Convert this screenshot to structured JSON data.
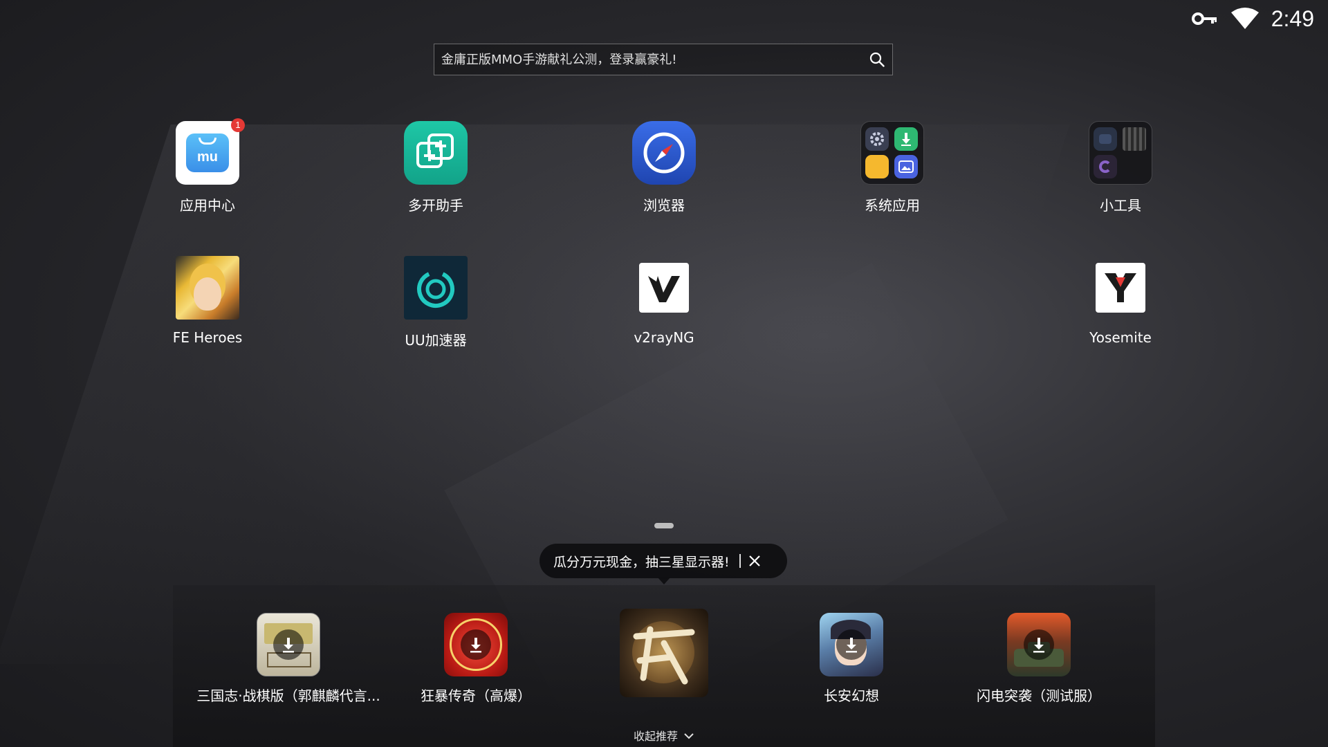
{
  "status_bar": {
    "time": "2:49",
    "icons": [
      "vpn-key-icon",
      "wifi-icon"
    ]
  },
  "search": {
    "placeholder": "金庸正版MMO手游献礼公测，登录赢豪礼!",
    "icon": "search-icon"
  },
  "apps": [
    {
      "label": "应用中心",
      "icon": "app-center-icon",
      "badge": "1"
    },
    {
      "label": "多开助手",
      "icon": "multi-open-icon"
    },
    {
      "label": "浏览器",
      "icon": "compass-browser-icon"
    },
    {
      "label": "系统应用",
      "icon": "system-apps-folder-icon"
    },
    {
      "label": "小工具",
      "icon": "tools-folder-icon"
    },
    {
      "label": "FE Heroes",
      "icon": "fe-heroes-icon"
    },
    {
      "label": "UU加速器",
      "icon": "uu-accelerator-icon"
    },
    {
      "label": "v2rayNG",
      "icon": "v2rayng-icon"
    },
    {
      "label": "Yosemite",
      "icon": "yosemite-icon"
    }
  ],
  "promo": {
    "text": "瓜分万元现金，抽三星显示器!",
    "close_icon": "close-icon"
  },
  "recommended": [
    {
      "label": "三国志·战棋版（郭麒麟代言...",
      "icon": "sanguozhi-game-icon",
      "download": true
    },
    {
      "label": "狂暴传奇（高爆）",
      "icon": "kuangbao-chuanqi-icon",
      "download": true
    },
    {
      "label": "",
      "icon": "tianlong-game-icon",
      "download": false
    },
    {
      "label": "长安幻想",
      "icon": "changan-huanxiang-icon",
      "download": true
    },
    {
      "label": "闪电突袭（测试服）",
      "icon": "shandian-tuxi-icon",
      "download": true
    }
  ],
  "collapse": {
    "label": "收起推荐",
    "icon": "chevron-down-icon"
  },
  "colors": {
    "badge": "#e53935",
    "app_center": "#4aa8f0",
    "multi_open": "#18b69a",
    "browser": "#2c5bd6",
    "uu": "#0f2a3a"
  }
}
